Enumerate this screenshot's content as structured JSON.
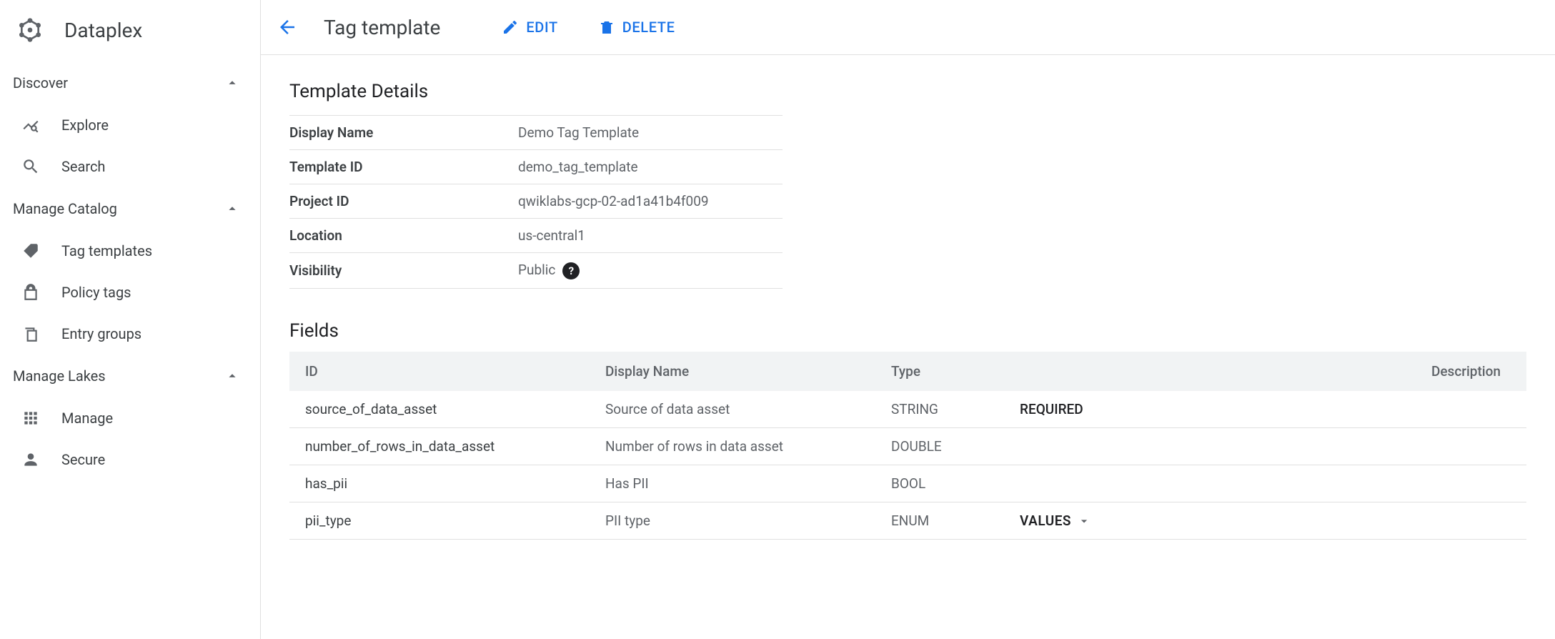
{
  "product": "Dataplex",
  "topbar": {
    "title": "Tag template",
    "edit_label": "EDIT",
    "delete_label": "DELETE"
  },
  "sidebar": {
    "sections": [
      {
        "label": "Discover",
        "items": [
          {
            "label": "Explore",
            "icon": "explore"
          },
          {
            "label": "Search",
            "icon": "search"
          }
        ]
      },
      {
        "label": "Manage Catalog",
        "items": [
          {
            "label": "Tag templates",
            "icon": "tag"
          },
          {
            "label": "Policy tags",
            "icon": "lock"
          },
          {
            "label": "Entry groups",
            "icon": "copy"
          }
        ]
      },
      {
        "label": "Manage Lakes",
        "items": [
          {
            "label": "Manage",
            "icon": "apps"
          },
          {
            "label": "Secure",
            "icon": "person"
          }
        ]
      }
    ]
  },
  "details": {
    "section_title": "Template Details",
    "rows": [
      {
        "label": "Display Name",
        "value": "Demo Tag Template"
      },
      {
        "label": "Template ID",
        "value": "demo_tag_template"
      },
      {
        "label": "Project ID",
        "value": "qwiklabs-gcp-02-ad1a41b4f009"
      },
      {
        "label": "Location",
        "value": "us-central1"
      },
      {
        "label": "Visibility",
        "value": "Public",
        "help": true
      }
    ]
  },
  "fields": {
    "section_title": "Fields",
    "columns": {
      "id": "ID",
      "name": "Display Name",
      "type": "Type",
      "desc": "Description"
    },
    "values_btn_label": "VALUES",
    "rows": [
      {
        "id": "source_of_data_asset",
        "name": "Source of data asset",
        "type": "STRING",
        "extra": "REQUIRED"
      },
      {
        "id": "number_of_rows_in_data_asset",
        "name": "Number of rows in data asset",
        "type": "DOUBLE",
        "extra": ""
      },
      {
        "id": "has_pii",
        "name": "Has PII",
        "type": "BOOL",
        "extra": ""
      },
      {
        "id": "pii_type",
        "name": "PII type",
        "type": "ENUM",
        "extra": "VALUES_BTN"
      }
    ]
  }
}
